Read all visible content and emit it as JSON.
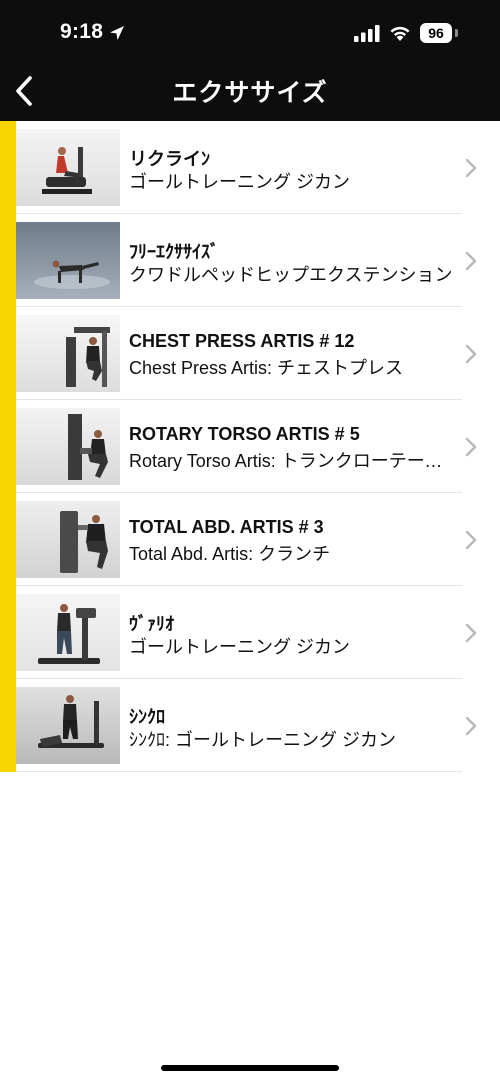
{
  "status_bar": {
    "time": "9:18",
    "battery": "96"
  },
  "header": {
    "title": "エクササイズ",
    "back_icon": "chevron-left-icon"
  },
  "colors": {
    "accent": "#f7d500",
    "header_bg": "#0d0d0d",
    "chevron": "#b8b8bc"
  },
  "items": [
    {
      "title": "リクライﾝ",
      "subtitle": "ゴールトレーニング ジカン",
      "thumb": "recumbent-bike"
    },
    {
      "title": "ﾌﾘｰｴｸｻｻｲｽﾞ",
      "subtitle": "クワドルペッドヒップエクステンション",
      "thumb": "free-exercise"
    },
    {
      "title": "CHEST PRESS ARTIS # 12",
      "subtitle": "Chest Press Artis: チェストプレス",
      "thumb": "chest-press"
    },
    {
      "title": "ROTARY TORSO ARTIS # 5",
      "subtitle": "Rotary Torso Artis: トランクローテーション",
      "thumb": "rotary-torso"
    },
    {
      "title": "TOTAL ABD. ARTIS # 3",
      "subtitle": "Total Abd. Artis: クランチ",
      "thumb": "total-abd"
    },
    {
      "title": "ｳﾞｧﾘｵ",
      "subtitle": "ゴールトレーニング ジカン",
      "thumb": "vario"
    },
    {
      "title": "ｼﾝｸﾛ",
      "subtitle": "ｼﾝｸﾛ: ゴールトレーニング ジカン",
      "thumb": "synchro"
    }
  ]
}
